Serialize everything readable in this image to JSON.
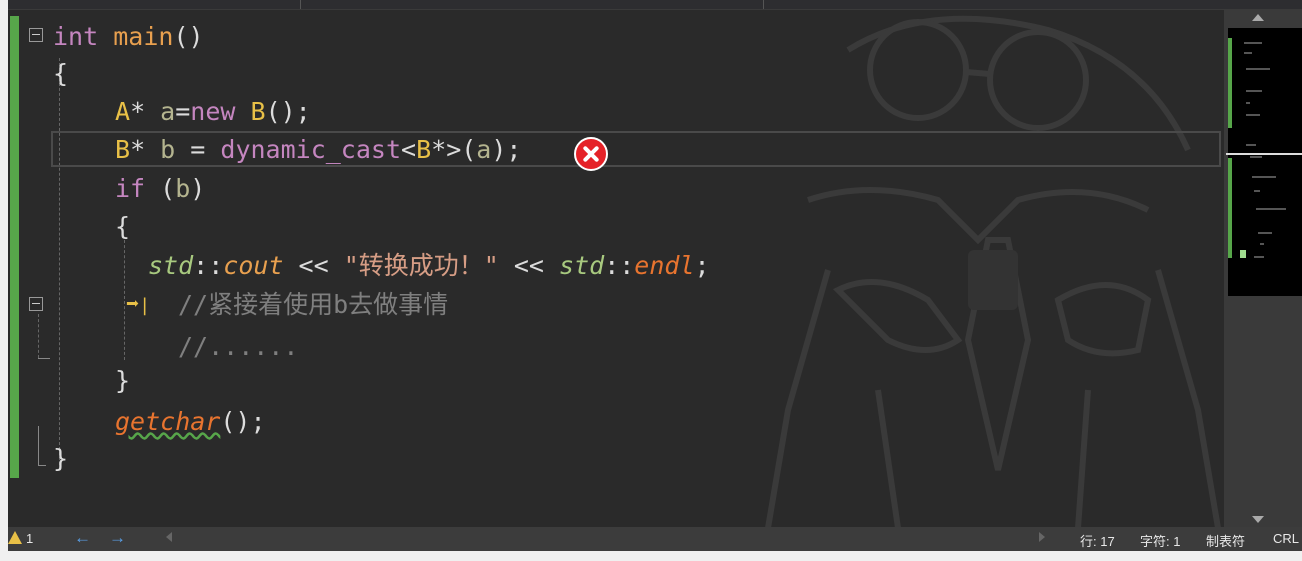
{
  "code": {
    "lines": [
      {
        "kw": "int",
        "fn": "main",
        "rest": "()"
      },
      {
        "text": "{"
      },
      {
        "ty": "A",
        "p1": "* ",
        "var": "a",
        "p2": "=",
        "kw": "new",
        "sp": " ",
        "ty2": "B",
        "p3": "();"
      },
      {
        "ty": "B",
        "p1": "* ",
        "var": "b",
        "p2": " = ",
        "kw": "dynamic_cast",
        "p3": "<",
        "ty2": "B",
        "p4": "*>(",
        "var2": "a",
        "p5": ");"
      },
      {
        "kw": "if",
        "p1": " (",
        "var": "b",
        "p2": ")"
      },
      {
        "text": "{"
      },
      {
        "ns": "std",
        "p1": "::",
        "cout": "cout",
        "p2": " << ",
        "str": "\"转换成功！\"",
        "p3": " << ",
        "ns2": "std",
        "p4": "::",
        "endl": "endl",
        "p5": ";"
      },
      {
        "cm": "//紧接着使用b去做事情"
      },
      {
        "cm": "//......"
      },
      {
        "text": "}"
      },
      {
        "getchar": "getchar",
        "p1": "();"
      },
      {
        "text": "}"
      }
    ]
  },
  "status": {
    "warnings": "1",
    "line": "行: 17",
    "char": "字符: 1",
    "tab": "制表符",
    "eol": "CRL"
  },
  "icons": {
    "nav_back": "←",
    "nav_forward": "→",
    "next_statement": "➡"
  },
  "colors": {
    "keyword": "#c586c0",
    "type": "#e8c047",
    "function": "#e8a04f",
    "comment": "#7f7f7f",
    "error": "#e52228",
    "change_bar": "#57a64a"
  }
}
